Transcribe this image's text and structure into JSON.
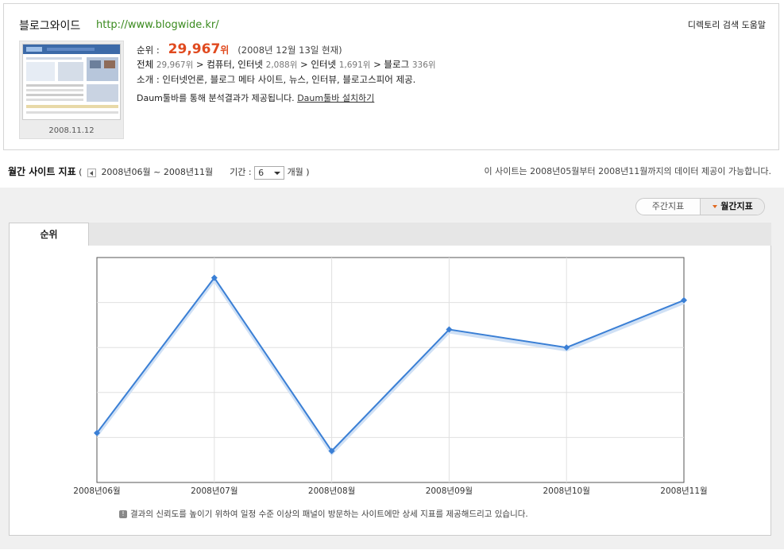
{
  "site": {
    "title": "블로그와이드",
    "url": "http://www.blogwide.kr/",
    "help_link": "디렉토리 검색 도움말",
    "thumbnail_date": "2008.11.12"
  },
  "rank": {
    "label": "순위 :",
    "value": "29,967",
    "unit": "위",
    "as_of": "(2008년 12월 13일 현재)"
  },
  "category_path": [
    {
      "name": "전체",
      "rank": "29,967위"
    },
    {
      "name": "컴퓨터, 인터넷",
      "rank": "2,088위"
    },
    {
      "name": "인터넷",
      "rank": "1,691위"
    },
    {
      "name": "블로그",
      "rank": "336위"
    }
  ],
  "intro": {
    "label": "소개 :",
    "text": "인터넷언론, 블로그 메타 사이트, 뉴스, 인터뷰, 블로고스피어 제공."
  },
  "toolbar_note": {
    "text": "Daum툴바를 통해 분석결과가 제공됩니다.",
    "link": "Daum툴바 설치하기"
  },
  "stats_header": {
    "title": "월간 사이트 지표",
    "open_paren": "(",
    "range": "2008년06월 ~ 2008년11월",
    "period_label": "기간 :",
    "period_value": "6",
    "period_unit": "개월 )",
    "availability": "이 사이트는 2008년05월부터 2008년11월까지의 데이터 제공이 가능합니다."
  },
  "toggle": {
    "weekly": "주간지표",
    "monthly": "월간지표"
  },
  "tab": {
    "active": "순위"
  },
  "footnote": "결과의 신뢰도를 높이기 위하여 일정 수준 이상의 패널이 방문하는 사이트에만 상세 지표를 제공해드리고 있습니다.",
  "colors": {
    "line": "#3a7fd5",
    "rank_highlight": "#e04a1f",
    "url": "#3a8a1e"
  },
  "chart_data": {
    "type": "line",
    "categories": [
      "2008년06월",
      "2008년07월",
      "2008년08월",
      "2008년09월",
      "2008년10월",
      "2008년11월"
    ],
    "series": [
      {
        "values": [
          0.78,
          0.09,
          0.86,
          0.32,
          0.4,
          0.19
        ]
      }
    ],
    "value_note": "normalized rank position (0=top of plot,1=bottom); no y-axis labels shown",
    "grid": true,
    "ylim": [
      0,
      1
    ]
  }
}
